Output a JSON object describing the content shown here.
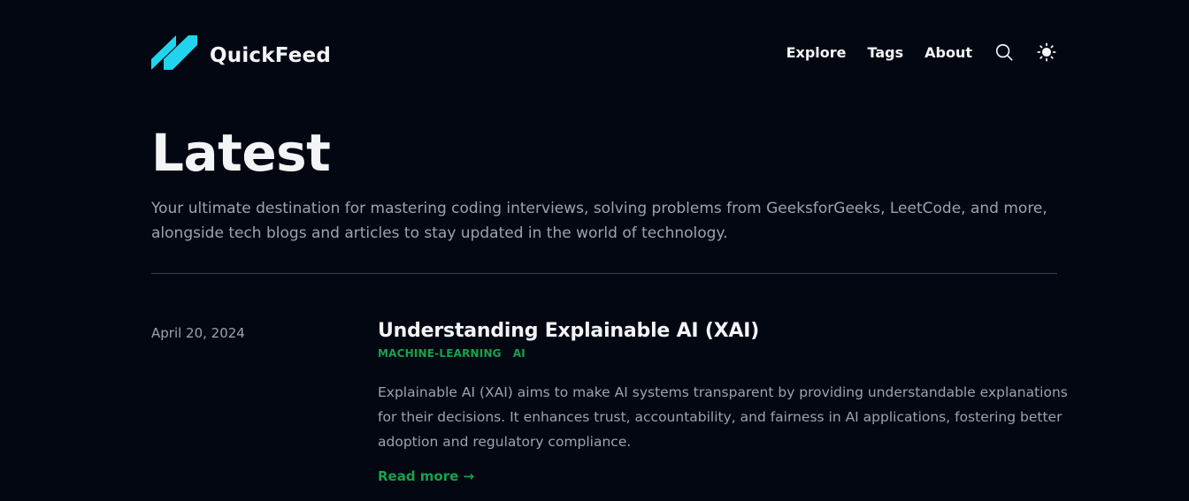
{
  "header": {
    "brand_name": "QuickFeed",
    "nav": [
      {
        "label": "Explore"
      },
      {
        "label": "Tags"
      },
      {
        "label": "About"
      }
    ],
    "search_icon": "search-icon",
    "theme_icon": "sun-icon"
  },
  "hero": {
    "title": "Latest",
    "description": "Your ultimate destination for mastering coding interviews, solving problems from GeeksforGeeks, LeetCode, and more, alongside tech blogs and articles to stay updated in the world of technology."
  },
  "posts": [
    {
      "date": "April 20, 2024",
      "title": "Understanding Explainable AI (XAI)",
      "tags": [
        "MACHINE-LEARNING",
        "AI"
      ],
      "summary": "Explainable AI (XAI) aims to make AI systems transparent by providing understandable explanations for their decisions. It enhances trust, accountability, and fairness in AI applications, fostering better adoption and regulatory compliance.",
      "read_more": "Read more →"
    }
  ],
  "colors": {
    "background": "#030712",
    "text": "#f3f4f6",
    "muted": "#9ca3af",
    "accent": "#16a34a",
    "logo": "#22d3ee"
  }
}
